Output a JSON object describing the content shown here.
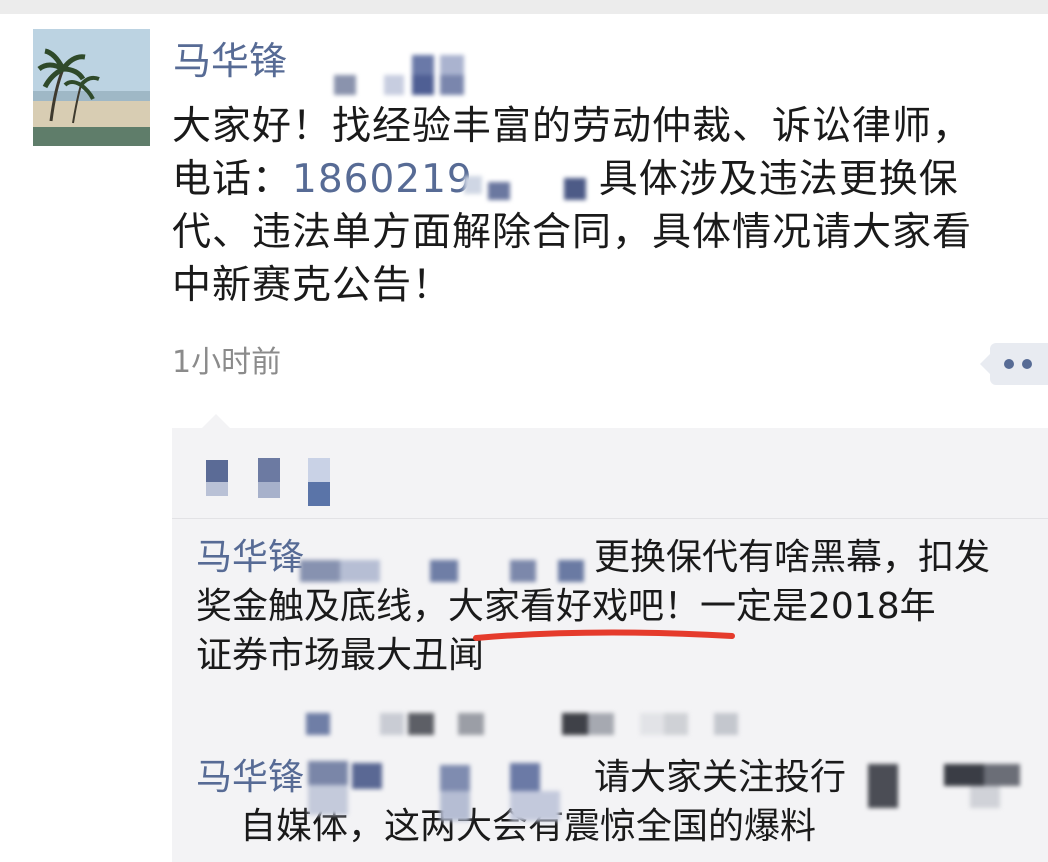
{
  "post": {
    "author": "马华锋",
    "text_line1": "大家好！找经验丰富的劳动仲裁、诉讼律师，",
    "text_line2_prefix": "电话：",
    "phone": "1860219",
    "text_line2_suffix": "具体涉及违法更换保",
    "text_line3": "代、违法单方面解除合同，具体情况请大家看",
    "text_line4": "中新赛克公告！",
    "time": "1小时前"
  },
  "comments": [
    {
      "author": "马华锋",
      "text_line1": "更换保代有啥黑幕，扣发",
      "text_line2": "奖金触及底线，大家看好戏吧！一定是2018年",
      "text_line3": "证券市场最大丑闻"
    },
    {
      "author": "马华锋",
      "text_line1": "请大家关注投行",
      "text_line2": "自媒体，这两大会有震惊全国的爆料"
    }
  ],
  "colors": {
    "name": "#576b95",
    "text": "#1a1a1a",
    "time": "#8b8b8b",
    "comment_bg": "#f3f3f5",
    "underline": "#e53b2c"
  }
}
